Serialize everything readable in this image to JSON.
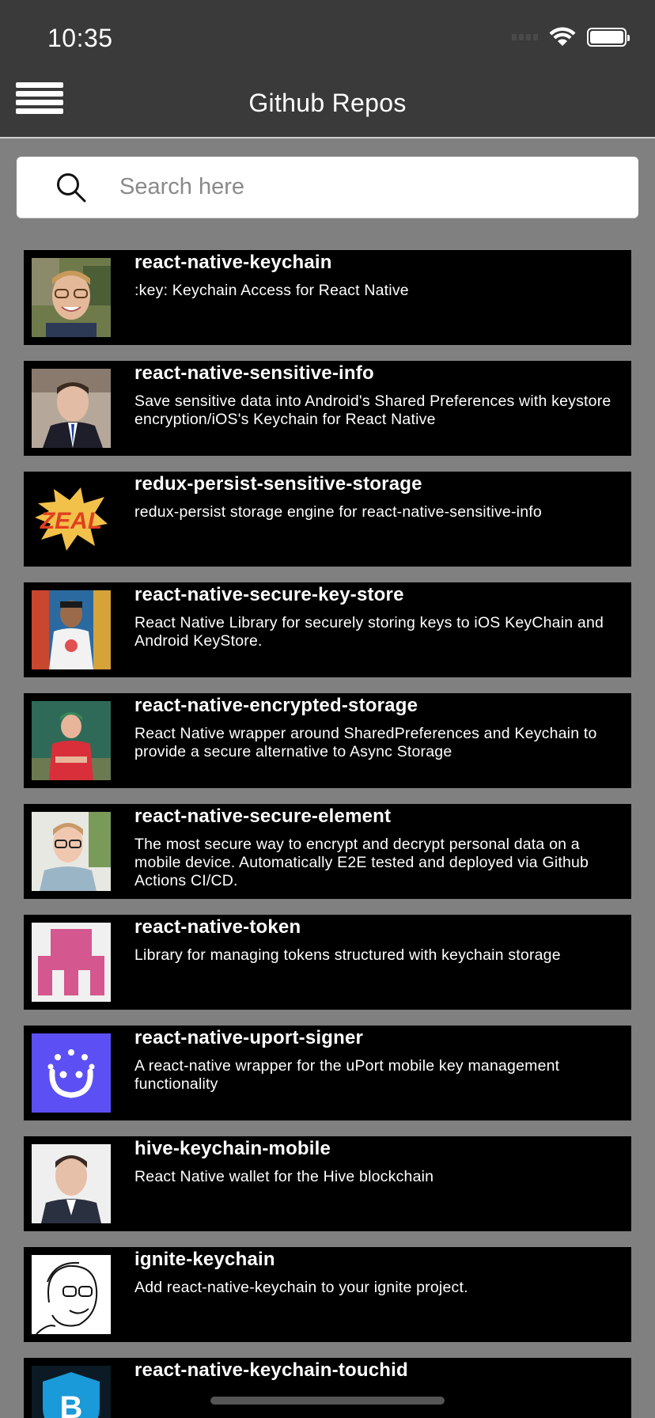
{
  "status_bar": {
    "time": "10:35"
  },
  "header": {
    "title": "Github Repos",
    "menu_icon": "hamburger-menu-icon"
  },
  "search": {
    "placeholder": "Search here",
    "value": "",
    "icon": "search-icon"
  },
  "repos": [
    {
      "name": "react-native-keychain",
      "description": ":key: Keychain Access for React Native",
      "avatar": "person-photo"
    },
    {
      "name": "react-native-sensitive-info",
      "description": "Save sensitive data into Android's Shared Preferences with keystore encryption/iOS's Keychain for React Native",
      "avatar": "person-photo"
    },
    {
      "name": "redux-persist-sensitive-storage",
      "description": "redux-persist storage engine for react-native-sensitive-info",
      "avatar": "zeal-logo"
    },
    {
      "name": "react-native-secure-key-store",
      "description": "React Native Library for securely storing keys to iOS KeyChain and Android KeyStore.",
      "avatar": "person-photo"
    },
    {
      "name": "react-native-encrypted-storage",
      "description": "React Native wrapper around SharedPreferences and Keychain to provide a secure alternative to Async Storage",
      "avatar": "person-photo"
    },
    {
      "name": "react-native-secure-element",
      "description": "The most secure way to encrypt and decrypt personal data on a mobile device. Automatically E2E tested and deployed via Github Actions CI/CD.",
      "avatar": "person-photo"
    },
    {
      "name": "react-native-token",
      "description": "Library for managing tokens structured with keychain storage",
      "avatar": "identicon"
    },
    {
      "name": "react-native-uport-signer",
      "description": "A react-native wrapper for the uPort mobile key management functionality",
      "avatar": "uport-logo"
    },
    {
      "name": "hive-keychain-mobile",
      "description": "React Native wallet for the Hive blockchain",
      "avatar": "person-photo"
    },
    {
      "name": "ignite-keychain",
      "description": "Add react-native-keychain to your ignite project.",
      "avatar": "sketch-portrait"
    },
    {
      "name": "react-native-keychain-touchid",
      "description": "",
      "avatar": "bitcoin-shield-logo"
    }
  ],
  "colors": {
    "background": "#808080",
    "header_bg": "#3a3a3a",
    "card_bg": "#000000",
    "text": "#ffffff",
    "uport_blue": "#5c50f5",
    "token_pink": "#d4578f"
  }
}
